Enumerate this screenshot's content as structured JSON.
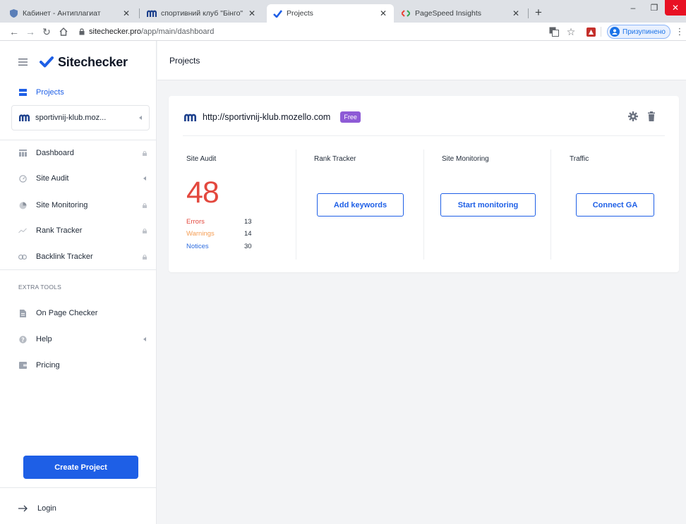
{
  "browser": {
    "tabs": [
      {
        "title": "Кабинет - Антиплагиат",
        "icon": "shield-favicon"
      },
      {
        "title": "спортивний клуб \"Бінго\" - Поча",
        "icon": "mozello-favicon"
      },
      {
        "title": "Projects",
        "icon": "sitechecker-favicon",
        "active": true
      },
      {
        "title": "PageSpeed Insights",
        "icon": "pagespeed-favicon"
      }
    ],
    "new_tab": "+",
    "url_host": "sitechecker.pro",
    "url_path": "/app/main/dashboard",
    "profile_label": "Призупинено"
  },
  "sidebar": {
    "brand": "Sitechecker",
    "projects_label": "Projects",
    "project_select": "sportivnij-klub.moz...",
    "nav": [
      {
        "label": "Dashboard",
        "trail": "lock"
      },
      {
        "label": "Site Audit",
        "trail": "arrow"
      },
      {
        "label": "Site Monitoring",
        "trail": "lock"
      },
      {
        "label": "Rank Tracker",
        "trail": "lock"
      },
      {
        "label": "Backlink Tracker",
        "trail": "lock"
      }
    ],
    "extra_caption": "EXTRA TOOLS",
    "extra": [
      {
        "label": "On Page Checker"
      },
      {
        "label": "Help",
        "trail": "arrow"
      },
      {
        "label": "Pricing"
      }
    ],
    "create_button": "Create Project",
    "login": "Login"
  },
  "main": {
    "header_title": "Projects",
    "project": {
      "url": "http://sportivnij-klub.mozello.com",
      "plan_badge": "Free",
      "site_audit": {
        "title": "Site Audit",
        "score": "48",
        "errors_label": "Errors",
        "errors": "13",
        "warnings_label": "Warnings",
        "warnings": "14",
        "notices_label": "Notices",
        "notices": "30"
      },
      "rank_tracker": {
        "title": "Rank Tracker",
        "button": "Add keywords"
      },
      "site_monitoring": {
        "title": "Site Monitoring",
        "button": "Start monitoring"
      },
      "traffic": {
        "title": "Traffic",
        "button": "Connect GA"
      }
    }
  },
  "colors": {
    "accent": "#1e5fe6",
    "score": "#e3483e",
    "warnings": "#f59e55",
    "notices": "#2d6cdf",
    "badge": "#8e5bd6"
  }
}
